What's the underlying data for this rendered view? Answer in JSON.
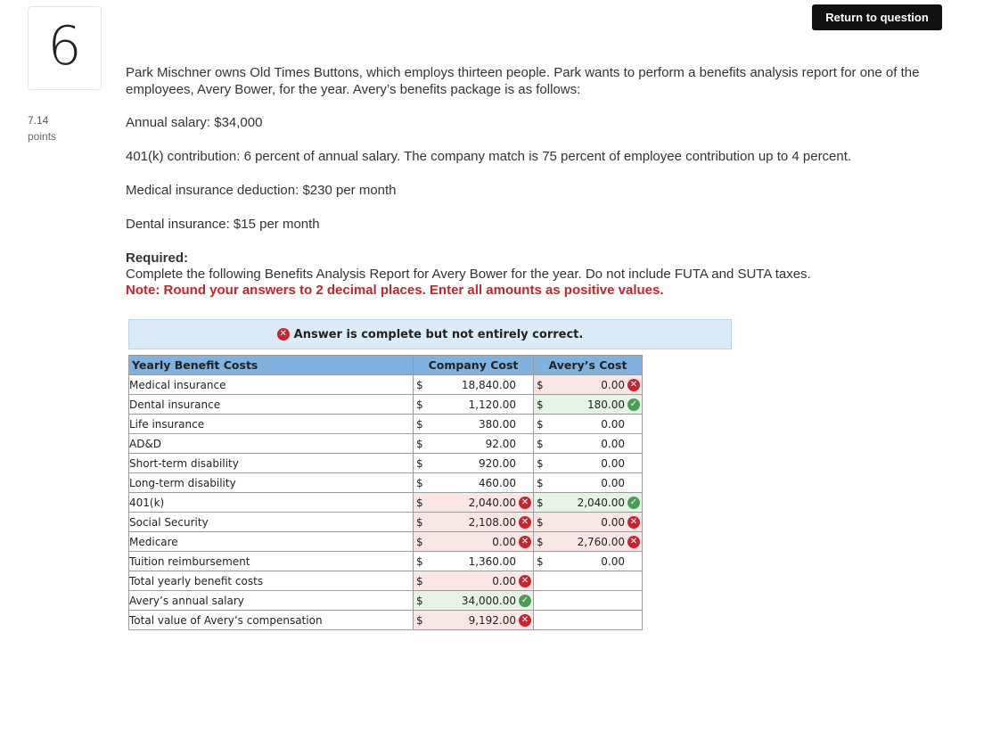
{
  "question": {
    "number": "6",
    "points_value": "7.14",
    "points_label": "points",
    "return_button": "Return to question",
    "intro": "Park Mischner owns Old Times Buttons, which employs thirteen people. Park wants to perform a benefits analysis report for one of the employees, Avery Bower, for the year. Avery’s benefits package is as follows:",
    "facts": [
      "Annual salary: $34,000",
      "401(k) contribution: 6 percent of annual salary. The company match is 75 percent of employee contribution up to 4 percent.",
      "Medical insurance deduction: $230 per month",
      "Dental insurance: $15 per month"
    ],
    "required_title": "Required:",
    "required_text": "Complete the following Benefits Analysis Report for Avery Bower for the year. Do not include FUTA and SUTA taxes.",
    "note": "Note: Round your answers to 2 decimal places. Enter all amounts as positive values."
  },
  "banner": {
    "text": "Answer is complete but not entirely correct."
  },
  "table": {
    "headers": [
      "Yearly Benefit Costs",
      "Company Cost",
      "Avery’s Cost"
    ],
    "currency": "$",
    "rows": [
      {
        "label": "Medical insurance",
        "company": "18,840.00",
        "company_mark": "",
        "avery": "0.00",
        "avery_mark": "x"
      },
      {
        "label": "Dental insurance",
        "company": "1,120.00",
        "company_mark": "",
        "avery": "180.00",
        "avery_mark": "check"
      },
      {
        "label": "Life insurance",
        "company": "380.00",
        "company_mark": "",
        "avery": "0.00",
        "avery_mark": ""
      },
      {
        "label": "AD&D",
        "company": "92.00",
        "company_mark": "",
        "avery": "0.00",
        "avery_mark": ""
      },
      {
        "label": "Short-term disability",
        "company": "920.00",
        "company_mark": "",
        "avery": "0.00",
        "avery_mark": ""
      },
      {
        "label": "Long-term disability",
        "company": "460.00",
        "company_mark": "",
        "avery": "0.00",
        "avery_mark": ""
      },
      {
        "label": "401(k)",
        "company": "2,040.00",
        "company_mark": "x",
        "avery": "2,040.00",
        "avery_mark": "check"
      },
      {
        "label": "Social Security",
        "company": "2,108.00",
        "company_mark": "x",
        "avery": "0.00",
        "avery_mark": "x"
      },
      {
        "label": "Medicare",
        "company": "0.00",
        "company_mark": "x",
        "avery": "2,760.00",
        "avery_mark": "x"
      },
      {
        "label": "Tuition reimbursement",
        "company": "1,360.00",
        "company_mark": "",
        "avery": "0.00",
        "avery_mark": ""
      },
      {
        "label": "Total yearly benefit costs",
        "company": "0.00",
        "company_mark": "x",
        "avery": null,
        "avery_mark": ""
      },
      {
        "label": "Avery’s annual salary",
        "company": "34,000.00",
        "company_mark": "check",
        "avery": null,
        "avery_mark": ""
      },
      {
        "label": "Total value of Avery’s compensation",
        "company": "9,192.00",
        "company_mark": "x",
        "avery": null,
        "avery_mark": ""
      }
    ]
  }
}
